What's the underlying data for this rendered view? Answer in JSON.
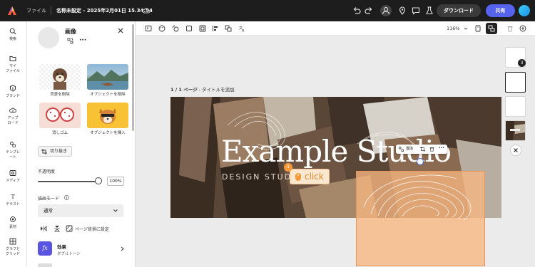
{
  "topbar": {
    "file_menu": "ファイル",
    "doc_title": "名称未設定 - 2025年2月01日 15.34.54",
    "download": "ダウンロード",
    "share": "共有"
  },
  "rail": {
    "items": [
      {
        "label": "検索",
        "icon": "search-icon"
      },
      {
        "label": "マイ\nファイル",
        "icon": "folder-icon"
      },
      {
        "label": "ブランド",
        "icon": "brand-icon"
      },
      {
        "label": "アップ\nロード",
        "icon": "upload-icon"
      },
      {
        "label": "テンプレ\nート",
        "icon": "template-icon"
      },
      {
        "label": "メディア",
        "icon": "media-icon"
      },
      {
        "label": "テキスト",
        "icon": "text-icon"
      },
      {
        "label": "素材",
        "icon": "elements-icon"
      },
      {
        "label": "グラフと\nグリッド",
        "icon": "grid-icon"
      }
    ]
  },
  "panel": {
    "title": "画像",
    "effects": [
      {
        "label": "背景を削除"
      },
      {
        "label": "オブジェクトを削除"
      },
      {
        "label": "消しゴム"
      },
      {
        "label": "オブジェクトを挿入"
      }
    ],
    "crop": "切り抜き",
    "opacity_label": "不透明度",
    "opacity_value": "100%",
    "blend_label": "描画モード",
    "blend_value": "通常",
    "bg_label": "ページ背景に設定",
    "effect_title": "効果",
    "effect_sub": "ダブルトーン",
    "fx": "fx"
  },
  "canvas": {
    "zoom": "116%",
    "page_label_prefix": "1 / 1 ページ",
    "page_label_suffix": " - タイトルを追加",
    "design_title": "Example Studio",
    "design_subtitle": "DESIGN STUDIO",
    "float_toolbar_label": "置換",
    "click_text": "click",
    "click_number": "1"
  },
  "pages": {
    "badge": "3"
  }
}
